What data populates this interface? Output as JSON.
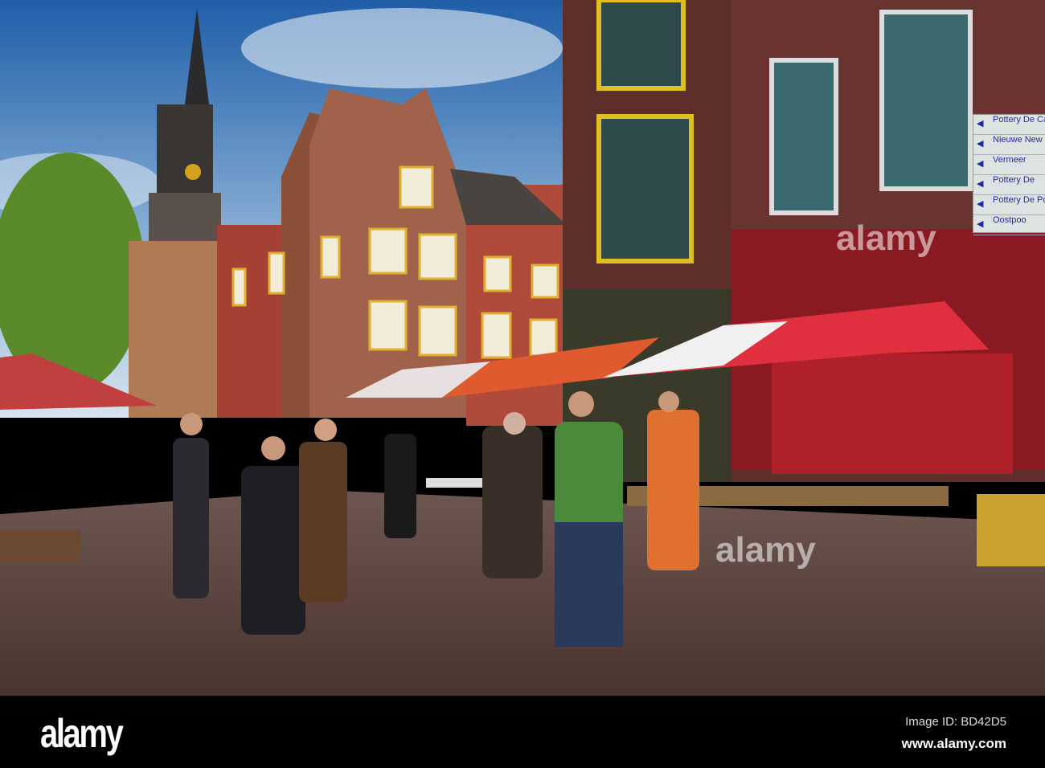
{
  "photo": {
    "subject": "street market",
    "signpost": [
      "Pottery De Cand",
      "Nieuwe New Ch",
      "Vermeer",
      "Pottery De",
      "Pottery De Por Royal Delft",
      "Oostpoo"
    ]
  },
  "watermark": {
    "center": "alamy",
    "lower": "alamy"
  },
  "footer": {
    "logo": "alamy",
    "image_id": "Image ID: BD42D5",
    "website": "www.alamy.com"
  }
}
